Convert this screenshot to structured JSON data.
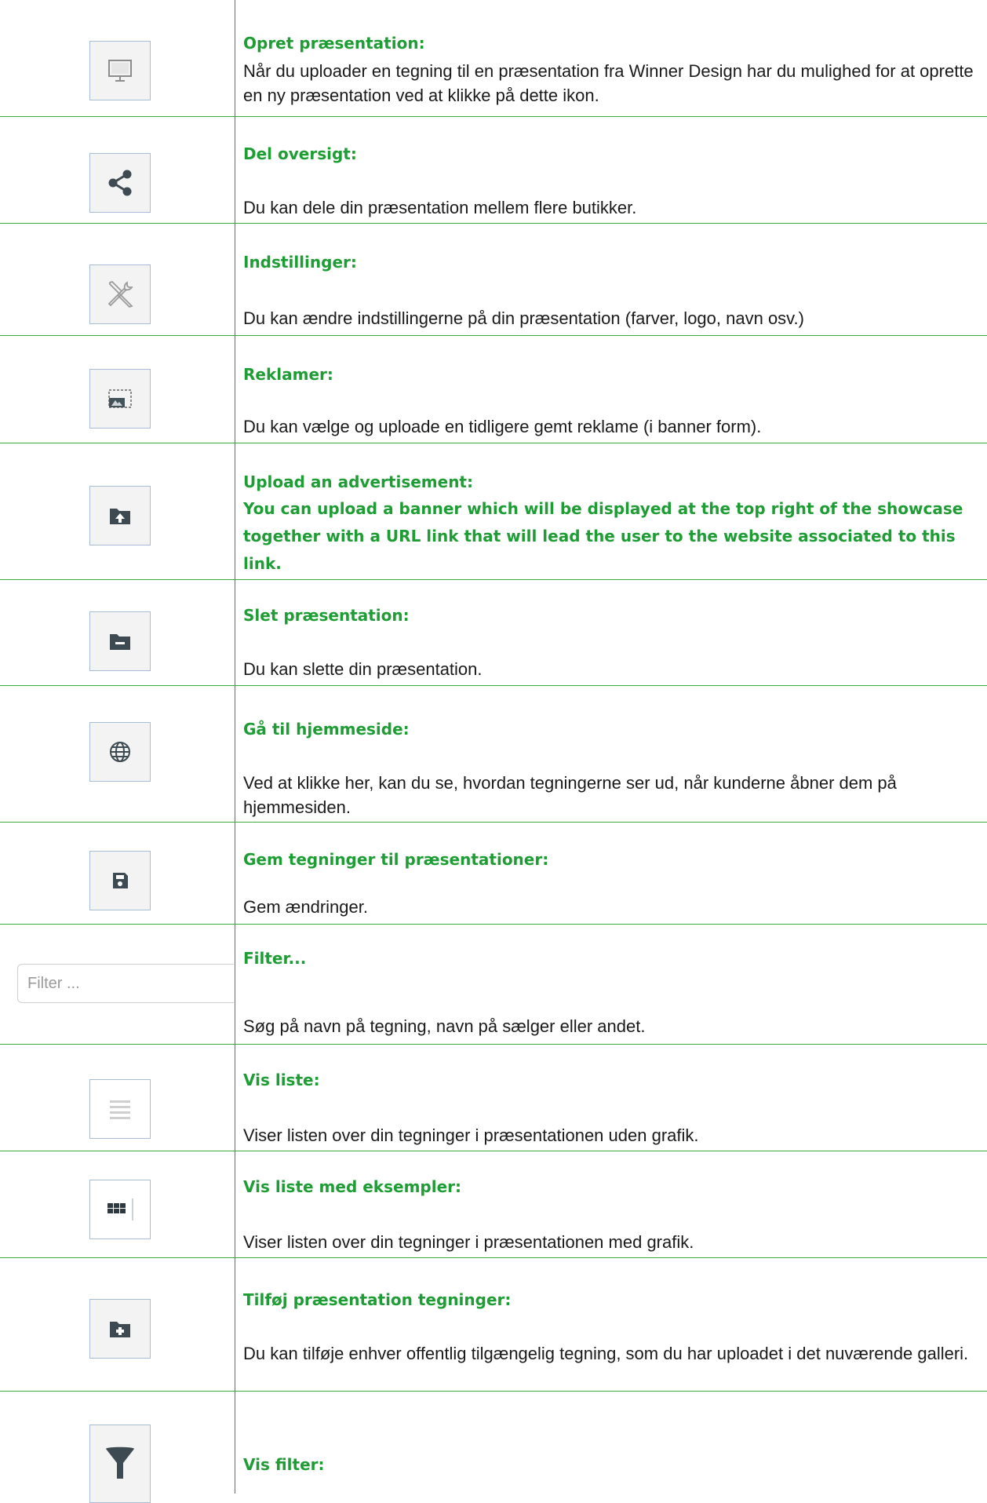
{
  "rows": [
    {
      "title": "Opret præsentation:",
      "desc": "Når du uploader en tegning til en præsentation fra Winner Design har du mulighed for at oprette en ny præsentation ved at klikke på dette ikon.",
      "icon": "monitor-icon"
    },
    {
      "title": "Del oversigt:",
      "desc": "Du kan dele din præsentation mellem flere butikker.",
      "icon": "share-icon"
    },
    {
      "title": "Indstillinger:",
      "desc": "Du kan ændre indstillingerne på din præsentation (farver, logo, navn osv.)",
      "icon": "wrench-screwdriver-icon"
    },
    {
      "title": "Reklamer:",
      "desc": "Du kan vælge og uploade en tidligere gemt reklame (i banner form).",
      "icon": "banner-image-icon"
    },
    {
      "title": "Upload an advertisement:",
      "desc": "You can upload a banner which will be displayed at the top right of the showcase together with a URL link that will lead the user to the website associated to this link.",
      "icon": "folder-upload-icon"
    },
    {
      "title": "Slet præsentation:",
      "desc": "Du kan slette din præsentation.",
      "icon": "folder-remove-icon"
    },
    {
      "title": "Gå til hjemmeside:",
      "desc": "Ved at klikke her, kan du se, hvordan tegningerne ser ud, når kunderne åbner dem på hjemmesiden.",
      "icon": "globe-icon"
    },
    {
      "title": "Gem tegninger til præsentationer:",
      "desc": "Gem ændringer.",
      "icon": "save-icon"
    },
    {
      "title": "Filter...",
      "desc": "Søg på navn på tegning, navn på sælger eller andet.",
      "placeholder": "Filter ..."
    },
    {
      "title": "Vis liste:",
      "desc": "Viser listen over din tegninger i præsentationen uden grafik.",
      "icon": "list-icon"
    },
    {
      "title": "Vis liste med eksempler:",
      "desc": "Viser listen over din tegninger i præsentationen med grafik.",
      "icon": "grid-icon"
    },
    {
      "title": "Tilføj præsentation tegninger:",
      "desc": "Du kan tilføje enhver offentlig tilgængelig tegning, som du har uploadet i det nuværende galleri.",
      "icon": "folder-add-icon"
    },
    {
      "title": "Vis filter:",
      "desc": "",
      "icon": "funnel-icon"
    }
  ],
  "colors": {
    "title_green": "#1f9d35",
    "row_border": "#3daa3d",
    "icon_dark": "#3d4a52",
    "icon_box_border": "#a7bdd3"
  }
}
